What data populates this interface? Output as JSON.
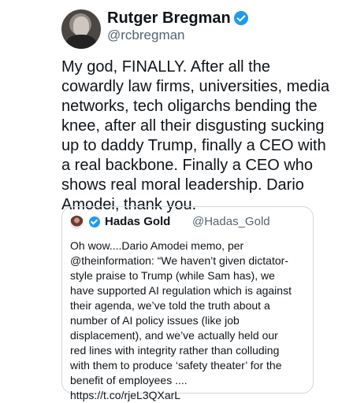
{
  "tweet": {
    "display_name": "Rutger Bregman",
    "handle": "@rcbregman",
    "text": "My god, FINALLY. After all the\ncowardly law firms, universities, media\nnetworks, tech oligarchs bending the\nknee, after all their disgusting sucking\nup to daddy Trump, finally a CEO with\na real backbone. Finally a CEO who\nshows real moral leadership. Dario\nAmodei, thank you.",
    "verified_color": "#1d9bf0"
  },
  "quoted_tweet": {
    "display_name": "Hadas Gold",
    "handle": "@Hadas_Gold",
    "text": "Oh wow....Dario Amodei memo, per\n@theinformation: “We haven’t given dictator-\nstyle praise to Trump (while Sam has), we\nhave supported AI regulation which is against\ntheir agenda, we’ve told the truth about a\nnumber of AI policy issues (like job\ndisplacement), and we’ve actually held our\nred lines with integrity rather than colluding\nwith them to produce ‘safety theater’ for the\nbenefit of employees ....\nhttps://t.co/rjeL3QXarL"
  },
  "icons": {
    "author_avatar": "avatar",
    "author_verified": "verified-badge-icon",
    "quoted_avatar": "avatar",
    "quoted_verified": "verified-badge-icon"
  }
}
